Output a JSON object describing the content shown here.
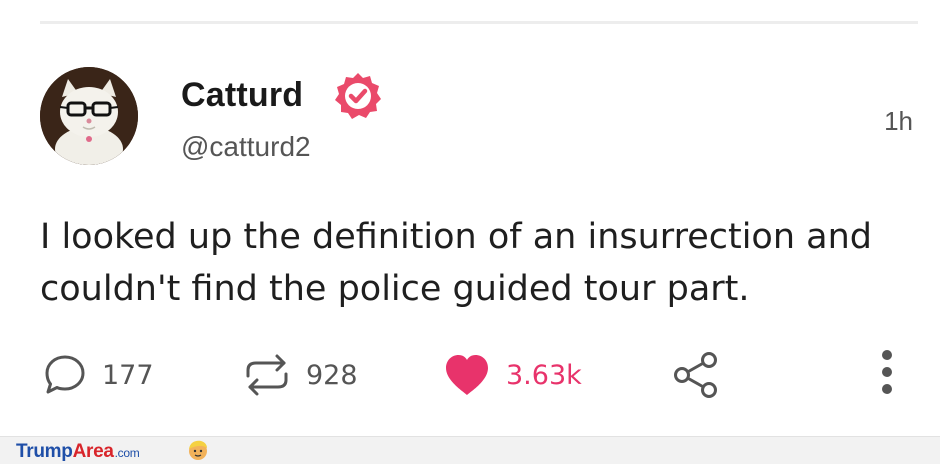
{
  "post": {
    "author_name": "Catturd",
    "handle": "@catturd2",
    "time": "1h",
    "verified": true,
    "text": "I looked up the definition of an insurrection and couldn't find the police guided tour part."
  },
  "actions": {
    "replies": "177",
    "reposts": "928",
    "likes": "3.63k",
    "liked": true
  },
  "watermark": {
    "part1": "Trump",
    "part2": "Area",
    "part3": ".com"
  },
  "colors": {
    "like": "#e8336b",
    "badge": "#ea4a6a",
    "text": "#1f1f1f",
    "muted": "#555555"
  },
  "icons": [
    "reply-icon",
    "repost-icon",
    "heart-icon",
    "share-icon",
    "more-icon",
    "verified-badge-icon"
  ]
}
